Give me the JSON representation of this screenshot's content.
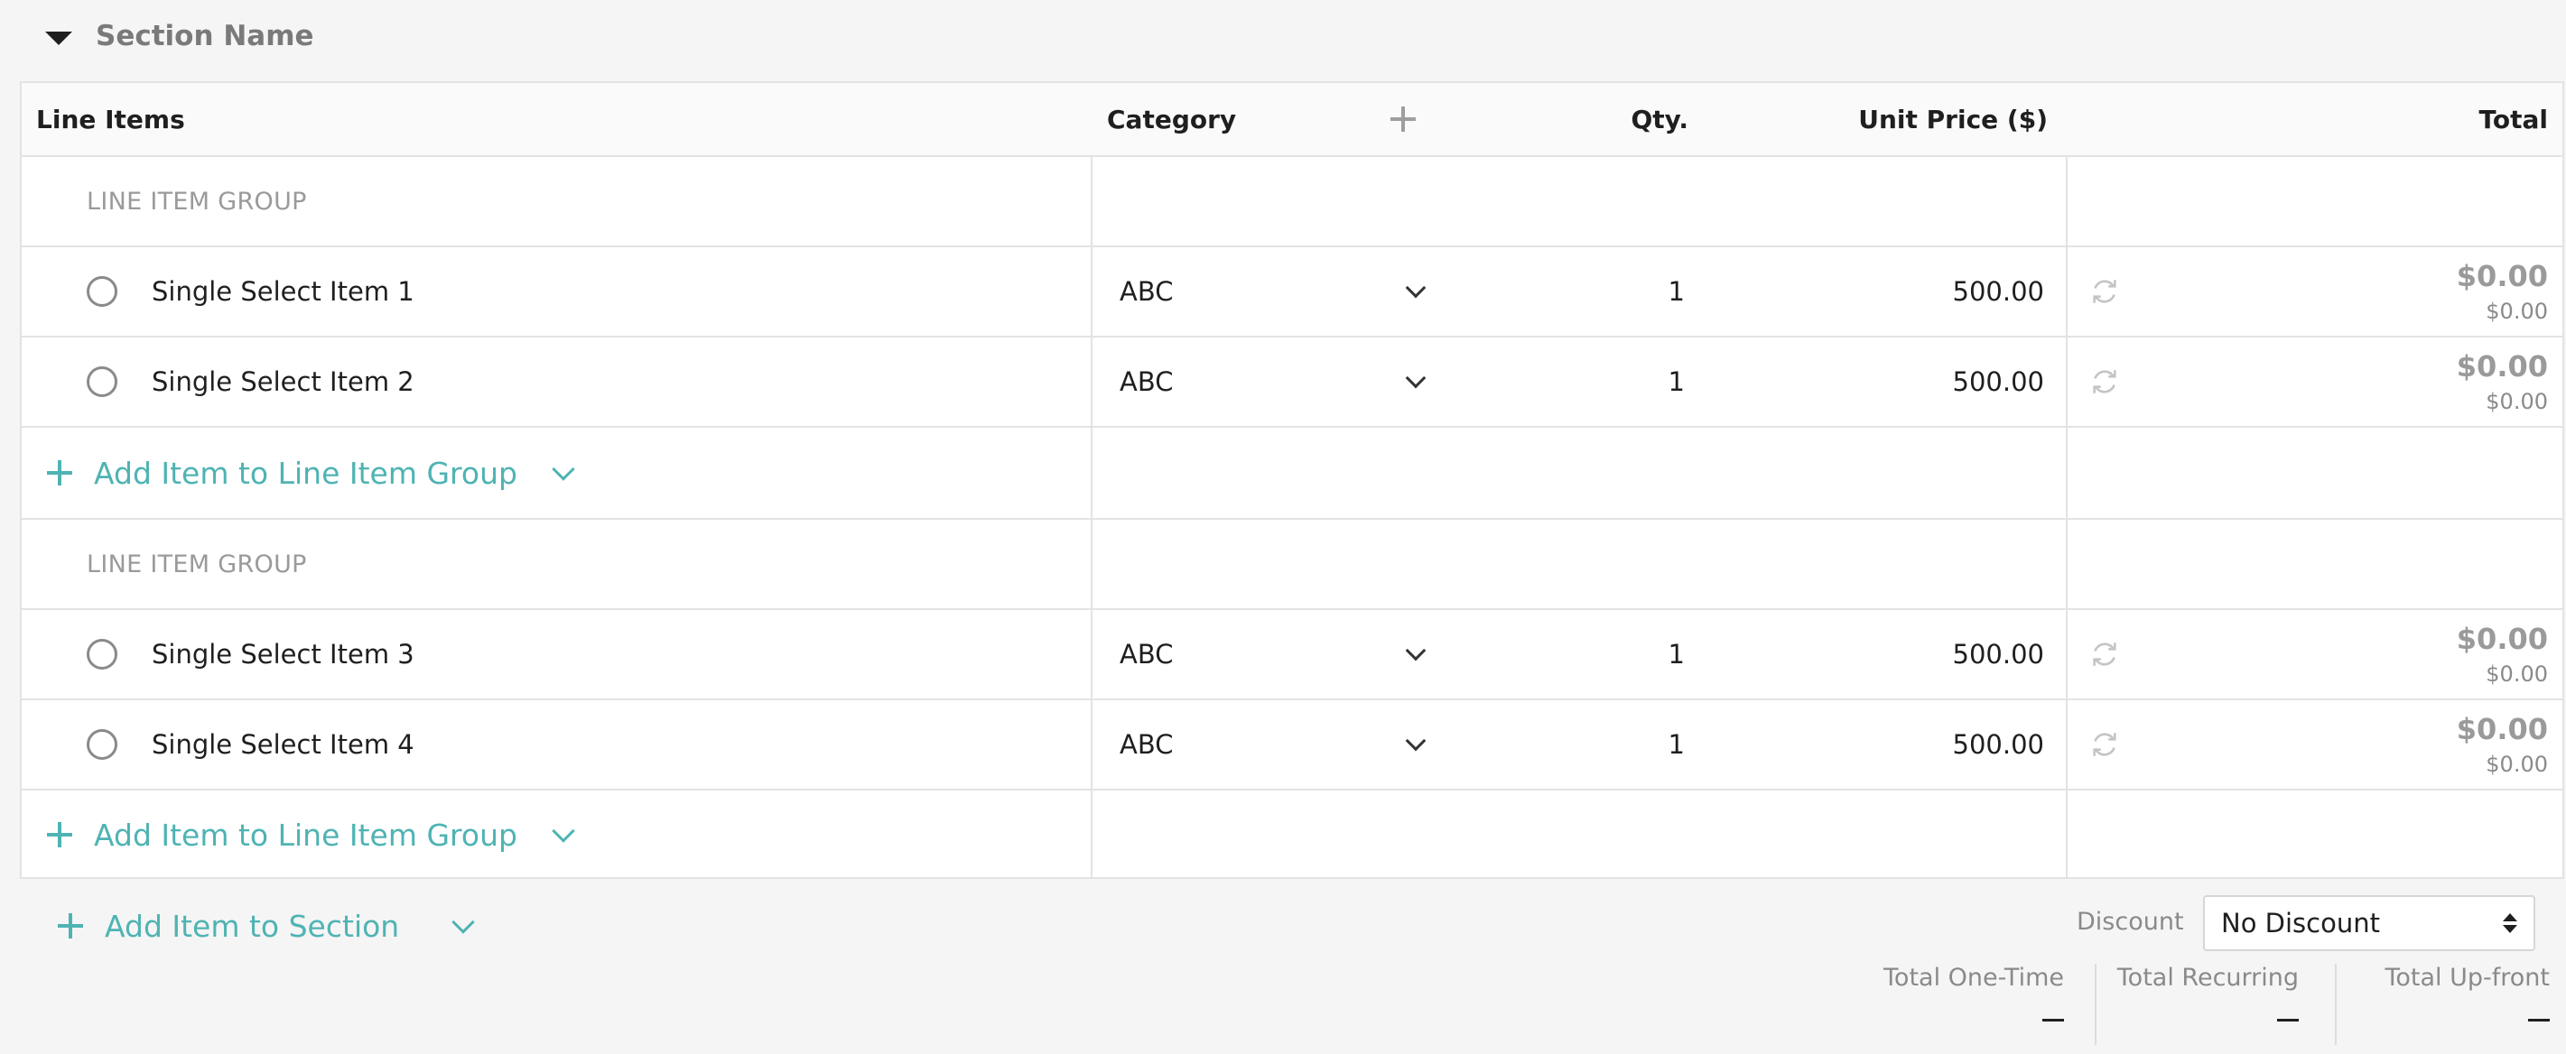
{
  "section": {
    "title": "Section Name"
  },
  "table": {
    "headers": {
      "line_items": "Line Items",
      "category": "Category",
      "qty": "Qty.",
      "unit_price": "Unit Price ($)",
      "total": "Total"
    },
    "groups": [
      {
        "label": "LINE ITEM GROUP",
        "items": [
          {
            "name": "Single Select Item 1",
            "category": "ABC",
            "qty": "1",
            "unit_price": "500.00",
            "total": "$0.00",
            "subtotal": "$0.00"
          },
          {
            "name": "Single Select Item 2",
            "category": "ABC",
            "qty": "1",
            "unit_price": "500.00",
            "total": "$0.00",
            "subtotal": "$0.00"
          }
        ],
        "add_label": "Add Item to Line Item Group"
      },
      {
        "label": "LINE ITEM GROUP",
        "items": [
          {
            "name": "Single Select Item 3",
            "category": "ABC",
            "qty": "1",
            "unit_price": "500.00",
            "total": "$0.00",
            "subtotal": "$0.00"
          },
          {
            "name": "Single Select Item 4",
            "category": "ABC",
            "qty": "1",
            "unit_price": "500.00",
            "total": "$0.00",
            "subtotal": "$0.00"
          }
        ],
        "add_label": "Add Item to Line Item Group"
      }
    ]
  },
  "add_section_item": "Add Item to Section",
  "discount": {
    "label": "Discount",
    "value": "No Discount"
  },
  "totals": [
    {
      "label": "Total One-Time",
      "value": "—"
    },
    {
      "label": "Total Recurring",
      "value": "—"
    },
    {
      "label": "Total Up-front",
      "value": "—"
    }
  ],
  "colors": {
    "accent": "#4fb3b3",
    "border": "#e3e3e3",
    "muted": "#9a9a9a"
  }
}
